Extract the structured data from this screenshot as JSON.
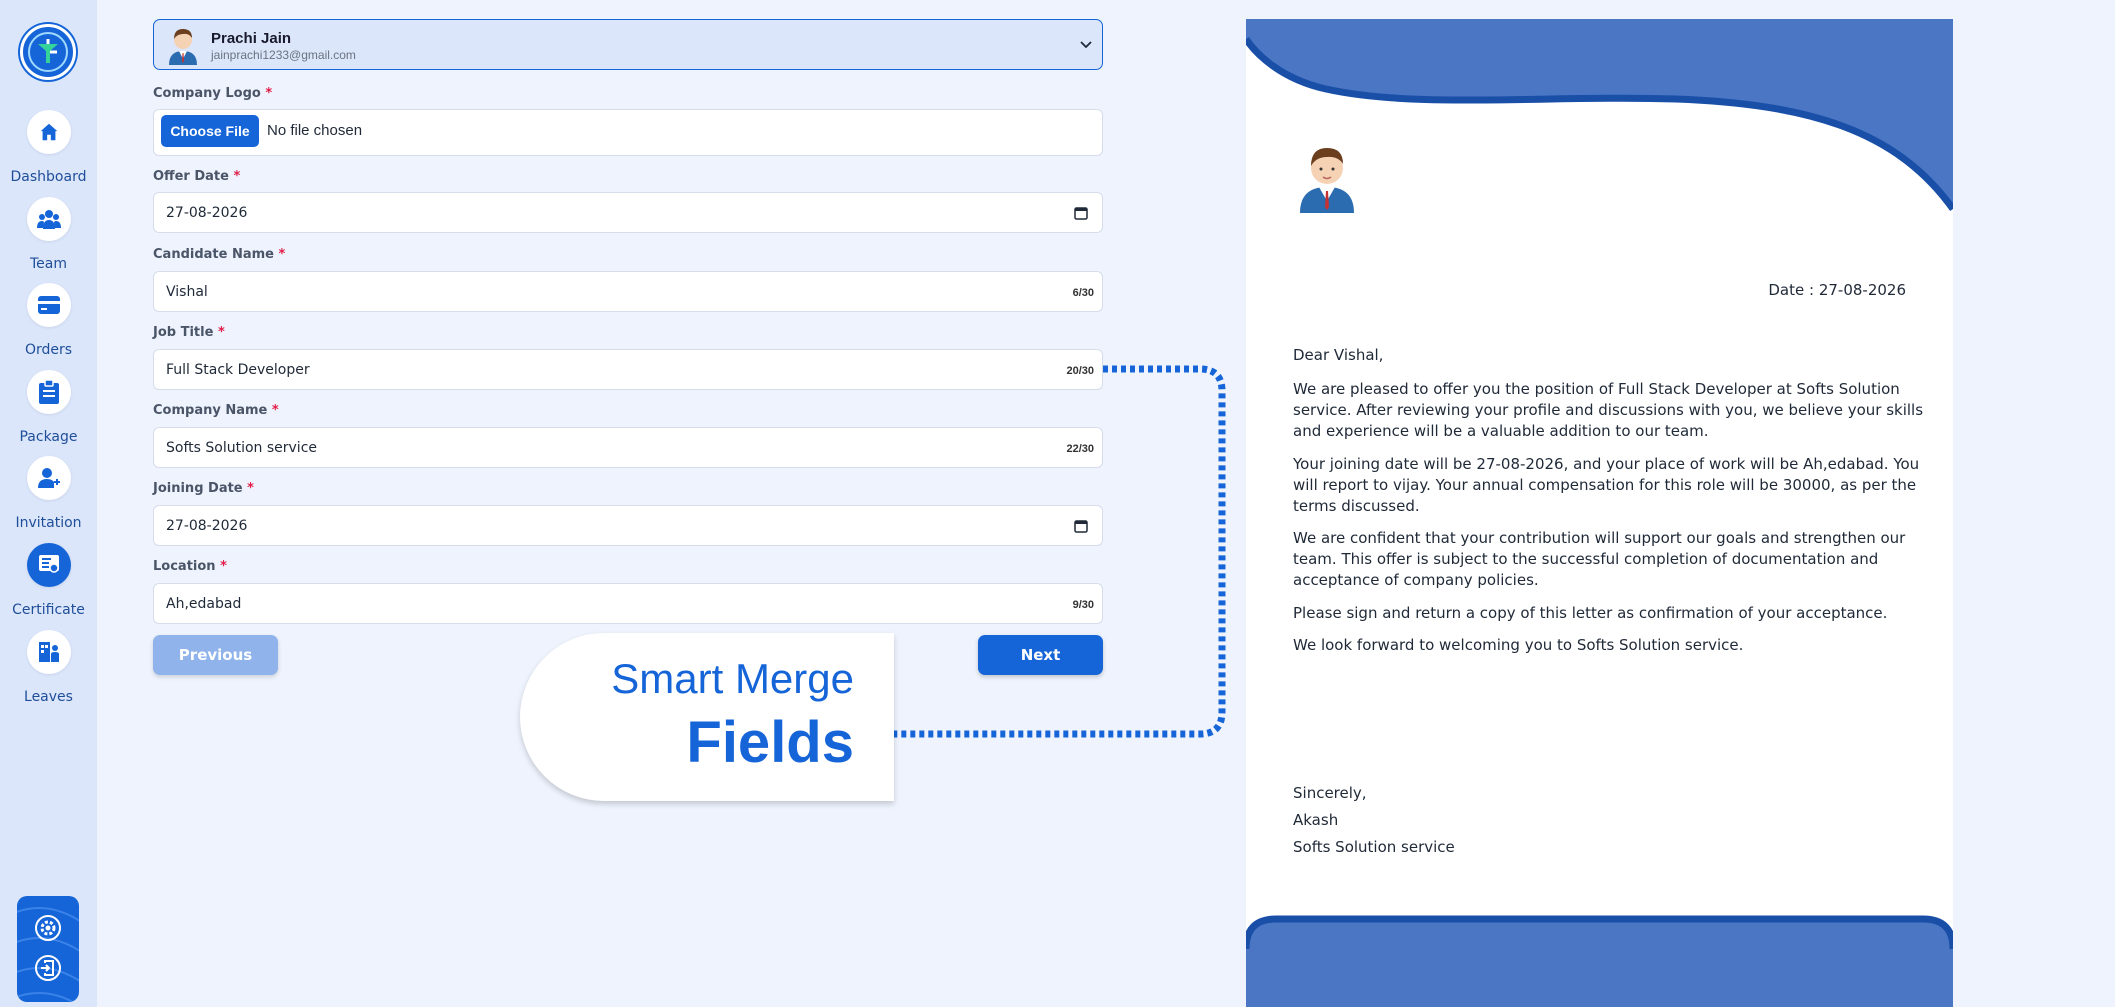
{
  "sidebar": {
    "logo_icon": "clock-logo-icon",
    "items": [
      {
        "label": "Dashboard",
        "icon": "home-icon"
      },
      {
        "label": "Team",
        "icon": "team-icon"
      },
      {
        "label": "Orders",
        "icon": "card-icon"
      },
      {
        "label": "Package",
        "icon": "clipboard-icon"
      },
      {
        "label": "Invitation",
        "icon": "add-user-icon"
      },
      {
        "label": "Certificate",
        "icon": "certificate-icon",
        "active": true
      },
      {
        "label": "Leaves",
        "icon": "leaves-icon"
      }
    ],
    "bottom": [
      "settings-icon",
      "logout-icon"
    ]
  },
  "user": {
    "name": "Prachi Jain",
    "email": "jainprachi1233@gmail.com"
  },
  "form": {
    "company_logo": {
      "label": "Company Logo",
      "button": "Choose File",
      "status": "No file chosen"
    },
    "offer_date": {
      "label": "Offer Date",
      "value": "27-08-2026"
    },
    "candidate_name": {
      "label": "Candidate Name",
      "value": "Vishal",
      "count": "6/30"
    },
    "job_title": {
      "label": "Job Title",
      "value": "Full Stack Developer",
      "count": "20/30"
    },
    "company_name": {
      "label": "Company Name",
      "value": "Softs Solution service",
      "count": "22/30"
    },
    "joining_date": {
      "label": "Joining Date",
      "value": "27-08-2026"
    },
    "location": {
      "label": "Location",
      "value": "Ah,edabad",
      "count": "9/30"
    },
    "required_mark": "*",
    "previous": "Previous",
    "next": "Next"
  },
  "callout": {
    "line1": "Smart Merge",
    "line2": "Fields"
  },
  "letter": {
    "date": "Date : 27-08-2026",
    "greeting": "Dear Vishal,",
    "p1": [
      "We are pleased to offer you the position of Full Stack Developer at Softs Solution",
      "service. After reviewing your profile and discussions with you, we believe your skills",
      "and experience will be a valuable addition to our team."
    ],
    "p2": [
      "Your joining date will be 27-08-2026, and your place of work will be Ah,edabad. You",
      "will report to vijay. Your annual compensation for this role will be 30000, as per the",
      "terms discussed."
    ],
    "p3": [
      "We are confident that your contribution will support our goals and strengthen our",
      "team. This offer is subject to the successful completion of documentation and",
      "acceptance of company policies."
    ],
    "p4": "Please sign and return a copy of this letter as confirmation of your acceptance.",
    "p5": "We look forward to welcoming you to Softs Solution service.",
    "closing": "Sincerely,",
    "signer": "Akash",
    "company": "Softs Solution service"
  },
  "colors": {
    "accent": "#1565d8",
    "sidebar": "#dbe6fb",
    "background": "#eef3fd",
    "letter_wave": "#4a76c4"
  }
}
